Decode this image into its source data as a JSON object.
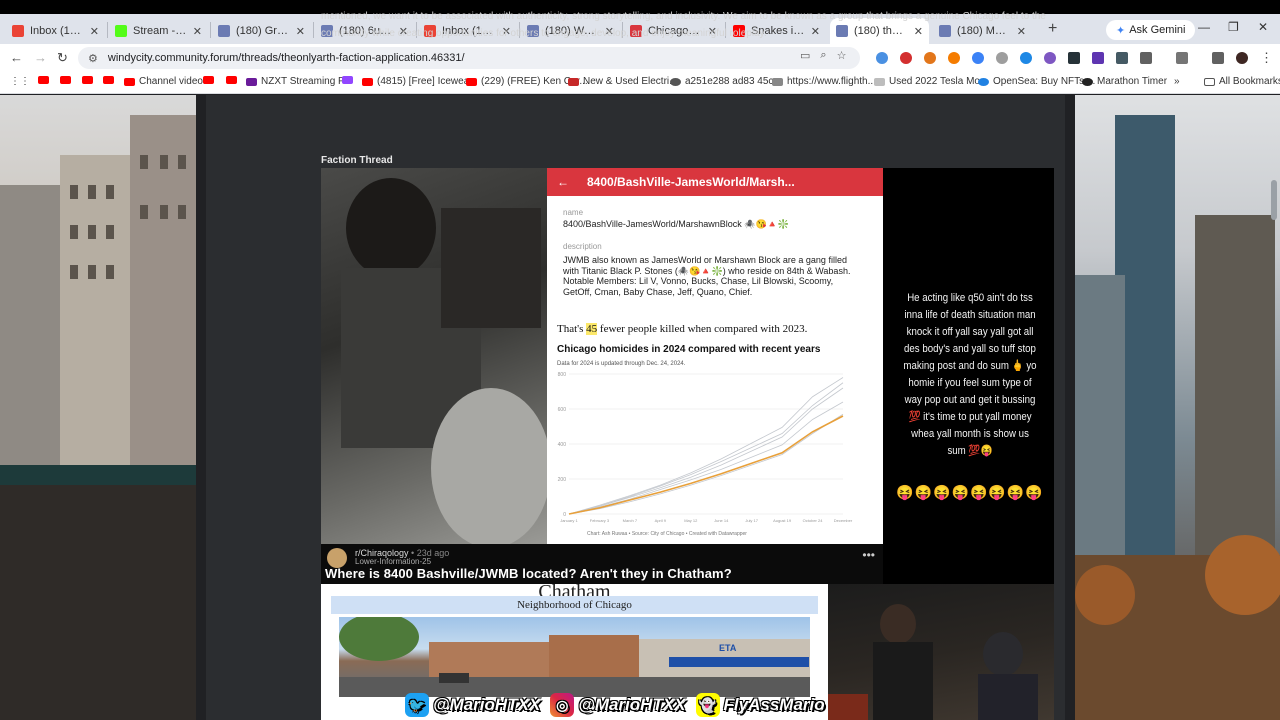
{
  "browser": {
    "tabs": [
      {
        "label": "Inbox (108,608)",
        "icon": "gmail-icon",
        "color": "#ea4335"
      },
      {
        "label": "Stream - Kick Do",
        "icon": "kick-icon",
        "color": "#53fc18"
      },
      {
        "label": "(180) Grinch Fac",
        "icon": "forum-icon",
        "color": "#6b7bb3"
      },
      {
        "label": "(180) 6urse Fact",
        "icon": "forum-icon",
        "color": "#6b7bb3"
      },
      {
        "label": "Inbox (108,608)",
        "icon": "gmail-icon",
        "color": "#ea4335"
      },
      {
        "label": "(180) Wek Facti",
        "icon": "forum-icon",
        "color": "#6b7bb3"
      },
      {
        "label": "Chicago Gang",
        "icon": "wiki-icon",
        "color": "#d9363e"
      },
      {
        "label": "Snakes in th",
        "icon": "youtube-icon",
        "color": "#ff0000"
      },
      {
        "label": "(180) theonlyar",
        "icon": "forum-icon",
        "color": "#6b7bb3",
        "active": true
      },
      {
        "label": "(180) MeRkz Fa",
        "icon": "forum-icon",
        "color": "#6b7bb3"
      }
    ],
    "new_tab": "+",
    "gemini_label": "Ask Gemini",
    "url": "windycity.community.forum/threads/theonlyarth-faction-application.46331/",
    "bookmarks": [
      "Channel videos",
      "NZXT Streaming PC",
      "(4815) [Free] Icewea...",
      "(229) (FREE) Ken Car...",
      "New & Used Electri...",
      "a251e288 ad83 45c...",
      "https://www.flighth...",
      "Used 2022 Tesla Mo...",
      "OpenSea: Buy NFTs,...",
      "Marathon Timer"
    ],
    "all_bookmarks": "All Bookmarks"
  },
  "post": {
    "paragraph_line1": "mentioned, we want it to be associated with authenticity, strong storytelling, and inclusivity. We aim to be known as a group that brings a genuine Chicago feel to the",
    "paragraph_line2": "community while creating opportunities for others to engage, develop, and enjoy meaningful roleplay.",
    "section_heading": "Faction Thread"
  },
  "phone_screenshot": {
    "header": "8400/BashVille-JamesWorld/Marsh...",
    "name_label": "name",
    "name_value": "8400/BashVille-JamesWorld/MarshawnBlock 🕷️😘🔺❇️",
    "description_label": "description",
    "description": "JWMB also known as JamesWorld or Marshawn Block are a gang filled with Titanic Black P. Stones (🕷️😘🔺❇️) who reside on 84th & Wabash. Notable Members: Lil V, Vonno, Bucks, Chase, Lil Blowski, Scoomy, GetOff, Cman, Baby Chase, Jeff, Quano, Chief.",
    "stat_prefix": "That's ",
    "stat_number": "45",
    "stat_suffix": " fewer people killed when compared with 2023."
  },
  "chart_data": {
    "type": "line",
    "title": "Chicago homicides in 2024 compared with recent years",
    "note": "Data for 2024 is updated through Dec. 24, 2024.",
    "source": "Chart: Ash Ruwaa • Source: City of Chicago • Created with Datawrapper",
    "x_ticks": [
      "January 1",
      "February 3",
      "March 7",
      "April 9",
      "May 12",
      "June 14",
      "July 17",
      "August 19",
      "October 24",
      "December"
    ],
    "y_ticks": [
      0,
      200,
      400,
      600,
      800
    ],
    "ylim": [
      0,
      800
    ],
    "series": [
      {
        "name": "2024",
        "color": "#e8a03a",
        "values": [
          0,
          35,
          80,
          125,
          175,
          230,
          290,
          350,
          470,
          560
        ]
      },
      {
        "color": "#c4c8ce",
        "values": [
          0,
          45,
          95,
          150,
          210,
          280,
          360,
          440,
          600,
          720
        ]
      },
      {
        "color": "#c4c8ce",
        "values": [
          0,
          50,
          105,
          165,
          235,
          315,
          405,
          495,
          670,
          780
        ]
      },
      {
        "color": "#c4c8ce",
        "values": [
          0,
          40,
          85,
          140,
          195,
          255,
          325,
          395,
          540,
          640
        ]
      },
      {
        "color": "#c4c8ce",
        "values": [
          0,
          30,
          70,
          115,
          165,
          220,
          280,
          340,
          460,
          570
        ]
      },
      {
        "color": "#c4c8ce",
        "values": [
          0,
          45,
          100,
          160,
          225,
          300,
          380,
          460,
          620,
          750
        ]
      }
    ]
  },
  "quote": {
    "text": "He acting like q50 ain't do tss inna life of death situation man knock it off yall say yall got all des body's and yall so tuff stop making post and do sum 🖕 yo homie if you feel sum type of way pop out and get it bussing 💯 it's time to put yall money whea yall month is show us sum 💯😝",
    "emojis": "😝😝😝😝😝😝😝😝"
  },
  "reddit": {
    "subreddit": "r/Chiraqology",
    "age": "• 23d ago",
    "username": "Lower-Information-25",
    "menu": "•••",
    "title": "Where is 8400 Bashville/JWMB located? Aren't they in Chatham?"
  },
  "chatham": {
    "title": "Chatham",
    "subtitle": "Neighborhood of Chicago",
    "sign": "ETA"
  },
  "watermark": {
    "twitter": "@MarioHTXX",
    "instagram": "@MarioHTXX",
    "snapchat": "FlyAssMario"
  }
}
